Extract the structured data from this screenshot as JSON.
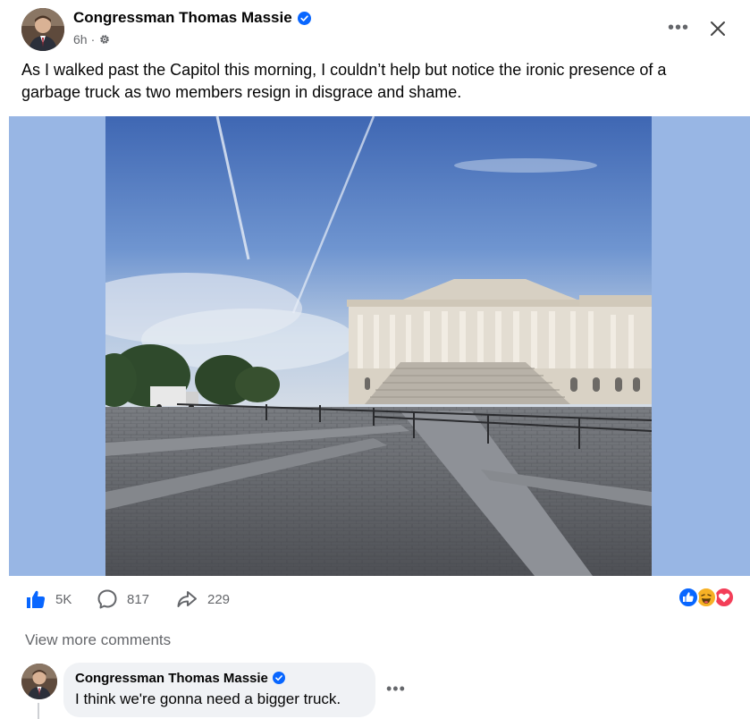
{
  "post": {
    "author": "Congressman Thomas Massie",
    "time": "6h",
    "separator": "·",
    "audience_icon": "gear-icon",
    "more_label": "•••",
    "close_icon": "close-icon",
    "text": "As I walked past the Capitol this morning, I couldn’t help but notice the ironic presence of a garbage truck as two members resign in disgrace and shame."
  },
  "stats": {
    "likes": "5K",
    "comments": "817",
    "shares": "229",
    "reaction_icons": [
      "like-icon",
      "haha-icon",
      "love-icon"
    ]
  },
  "comments": {
    "view_more": "View more comments",
    "items": [
      {
        "author": "Congressman Thomas Massie",
        "text": "I think we're gonna need a bigger truck.",
        "more_label": "•••"
      }
    ]
  },
  "colors": {
    "brand_blue": "#0866ff",
    "media_background": "#98b6e4",
    "secondary_text": "#65676b",
    "comment_bubble": "#f0f2f5"
  }
}
